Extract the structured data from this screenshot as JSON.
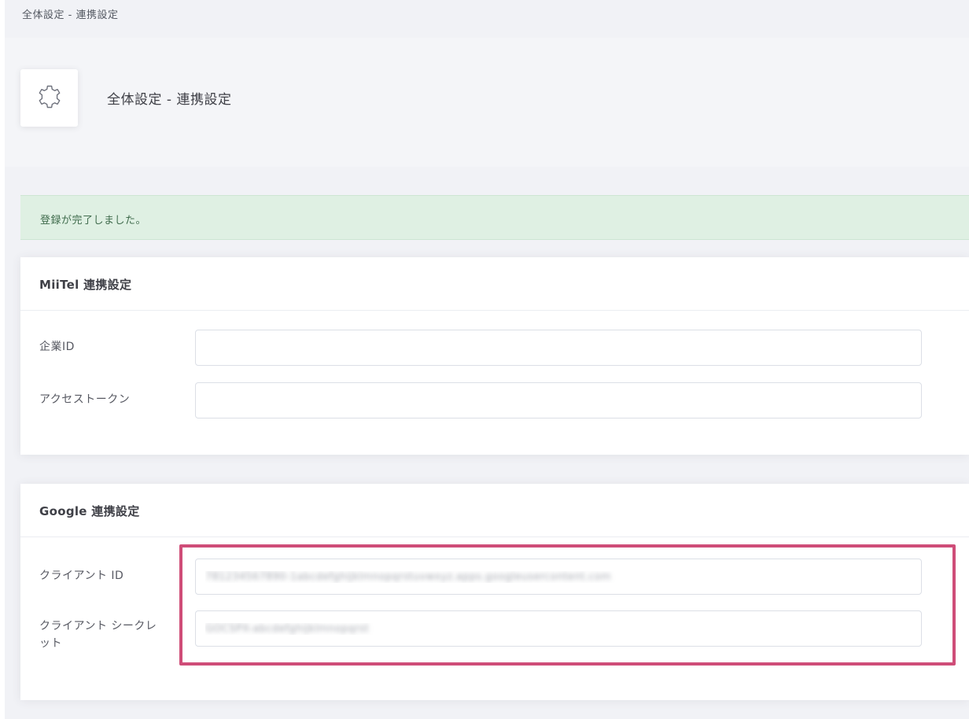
{
  "breadcrumb": "全体設定 - 連携設定",
  "header": {
    "title": "全体設定 - 連携設定",
    "icon": "gear-icon"
  },
  "alert": {
    "message": "登録が完了しました。",
    "color": "#dff0e3"
  },
  "miitel": {
    "title": "MiiTel 連携設定",
    "company_id_label": "企業ID",
    "company_id_value": "",
    "access_token_label": "アクセストークン",
    "access_token_value": ""
  },
  "google": {
    "title": "Google 連携設定",
    "client_id_label": "クライアント ID",
    "client_id_value": "781234567890-1abcdefghijklmnopqrstuvwxyz.apps.googleusercontent.com",
    "client_secret_label": "クライアント シークレット",
    "client_secret_value": "GOCSPX-abcdefghijklmnopqrst"
  },
  "colors": {
    "highlight": "#cf4d78",
    "page_bg": "#f1f2f6"
  }
}
